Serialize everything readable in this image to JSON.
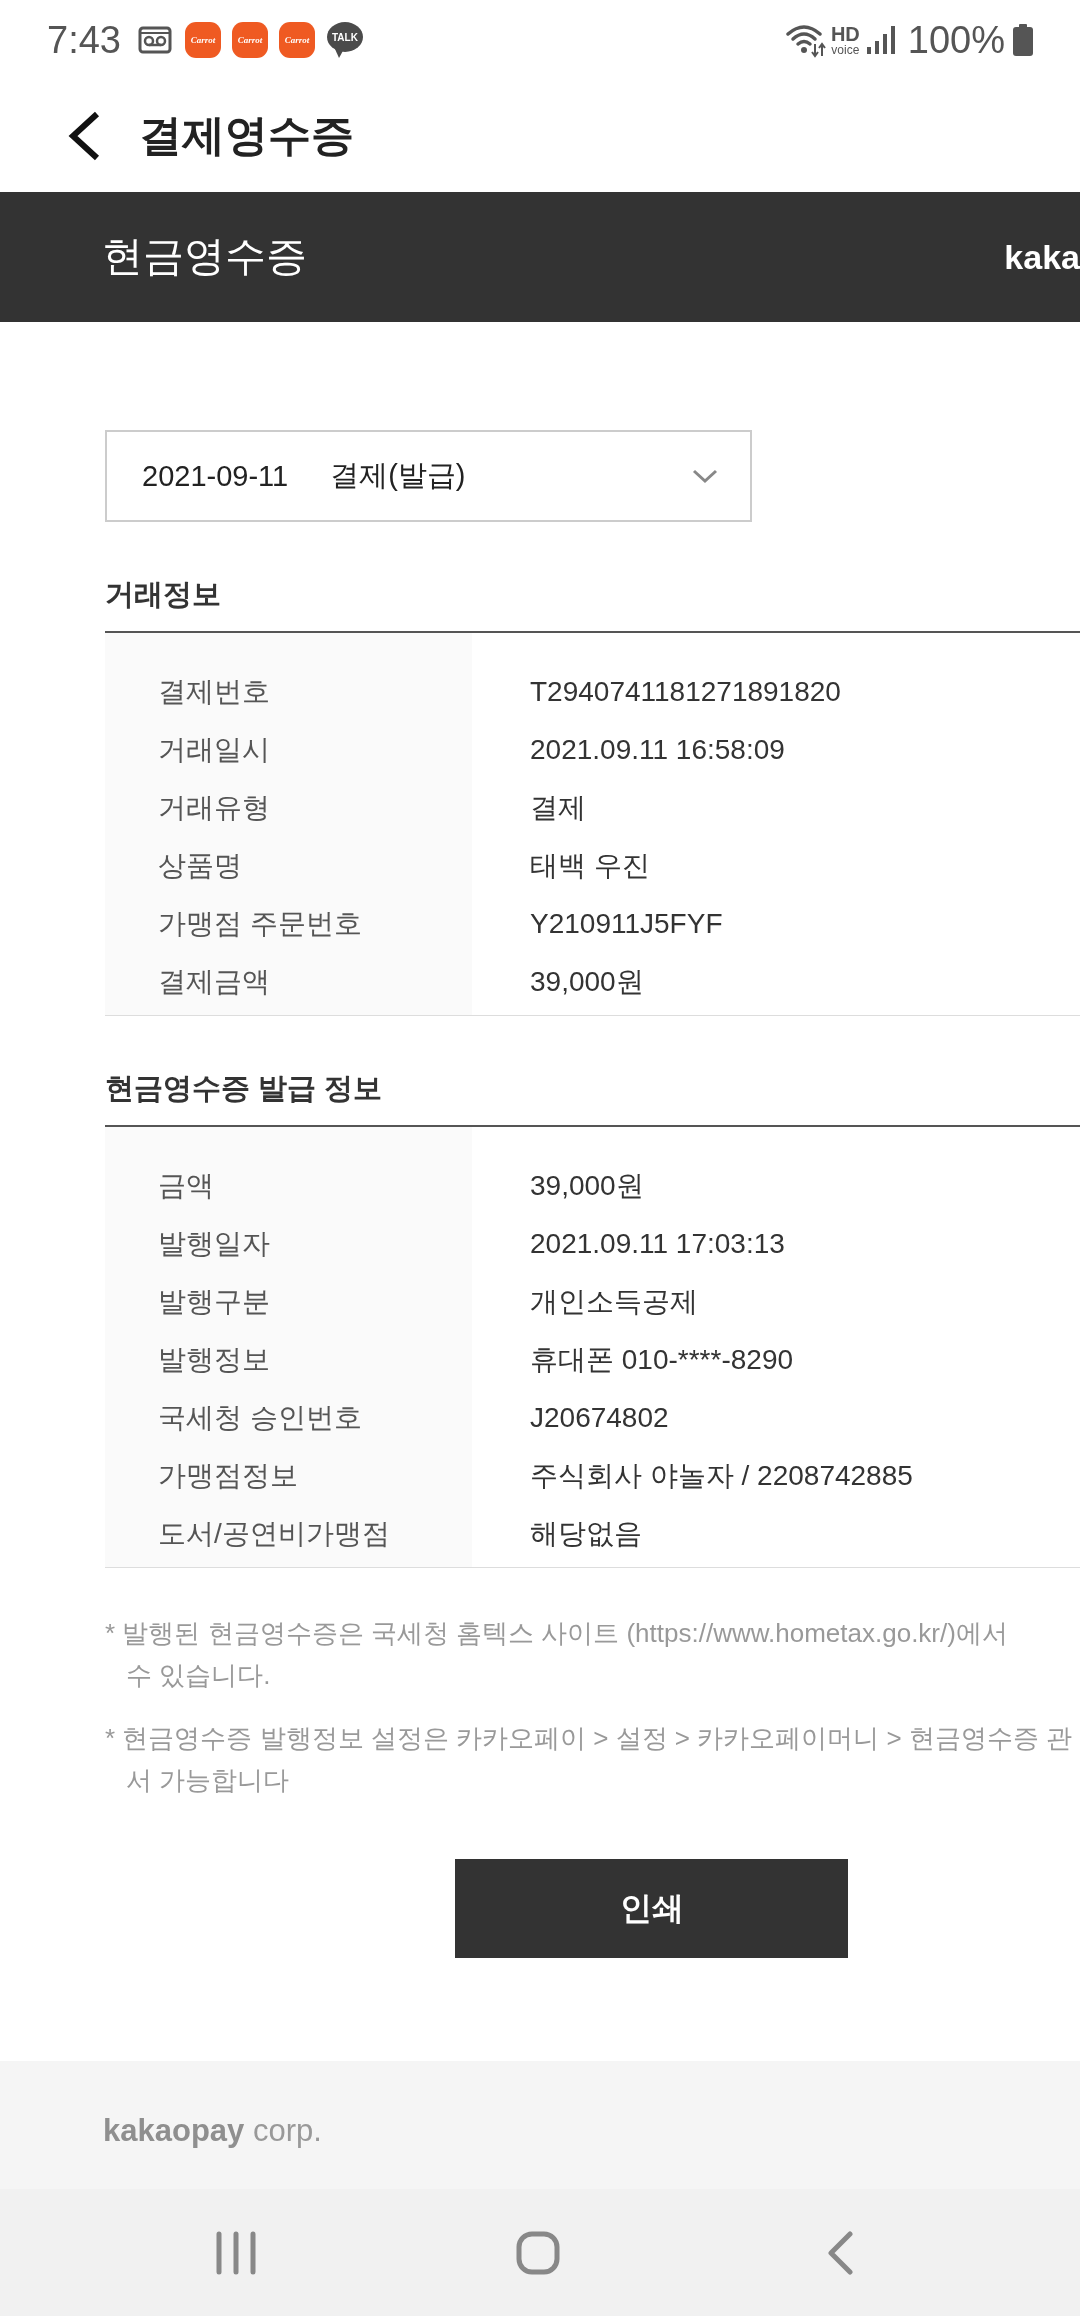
{
  "status_bar": {
    "time": "7:43",
    "notifications": [
      {
        "kind": "voicemail"
      },
      {
        "kind": "app",
        "label": "Carrot"
      },
      {
        "kind": "app",
        "label": "Carrot"
      },
      {
        "kind": "app",
        "label": "Carrot"
      },
      {
        "kind": "talk",
        "label": "TALK"
      }
    ],
    "hd_voice": {
      "top": "HD",
      "bottom": "voice"
    },
    "battery": "100%"
  },
  "app_bar": {
    "title": "결제영수증"
  },
  "banner": {
    "title": "현금영수증",
    "brand": "kaka"
  },
  "receipt_select": {
    "date": "2021-09-11",
    "type": "결제(발급)"
  },
  "sections": [
    {
      "title": "거래정보",
      "rows": [
        {
          "label": "결제번호",
          "value": "T2940741181271891820"
        },
        {
          "label": "거래일시",
          "value": "2021.09.11 16:58:09"
        },
        {
          "label": "거래유형",
          "value": "결제"
        },
        {
          "label": "상품명",
          "value": "태백 우진"
        },
        {
          "label": "가맹점 주문번호",
          "value": "Y210911J5FYF"
        },
        {
          "label": "결제금액",
          "value": "39,000원"
        }
      ]
    },
    {
      "title": "현금영수증 발급 정보",
      "rows": [
        {
          "label": "금액",
          "value": "39,000원"
        },
        {
          "label": "발행일자",
          "value": "2021.09.11 17:03:13"
        },
        {
          "label": "발행구분",
          "value": "개인소득공제"
        },
        {
          "label": "발행정보",
          "value": "휴대폰 010-****-8290"
        },
        {
          "label": "국세청 승인번호",
          "value": "J20674802"
        },
        {
          "label": "가맹점정보",
          "value": "주식회사 야놀자 / 2208742885"
        },
        {
          "label": "도서/공연비가맹점",
          "value": "해당없음"
        }
      ]
    }
  ],
  "notes": [
    {
      "lines": [
        "* 발행된 현금영수증은 국세청 홈텍스 사이트 (https://www.hometax.go.kr/)에서",
        "수 있습니다."
      ]
    },
    {
      "lines": [
        "* 현금영수증 발행정보 설정은 카카오페이 > 설정 > 카카오페이머니 > 현금영수증 관",
        "서 가능합니다"
      ]
    }
  ],
  "print_button": {
    "label": "인쇄"
  },
  "footer": {
    "company": "**kakaopay** corp."
  }
}
